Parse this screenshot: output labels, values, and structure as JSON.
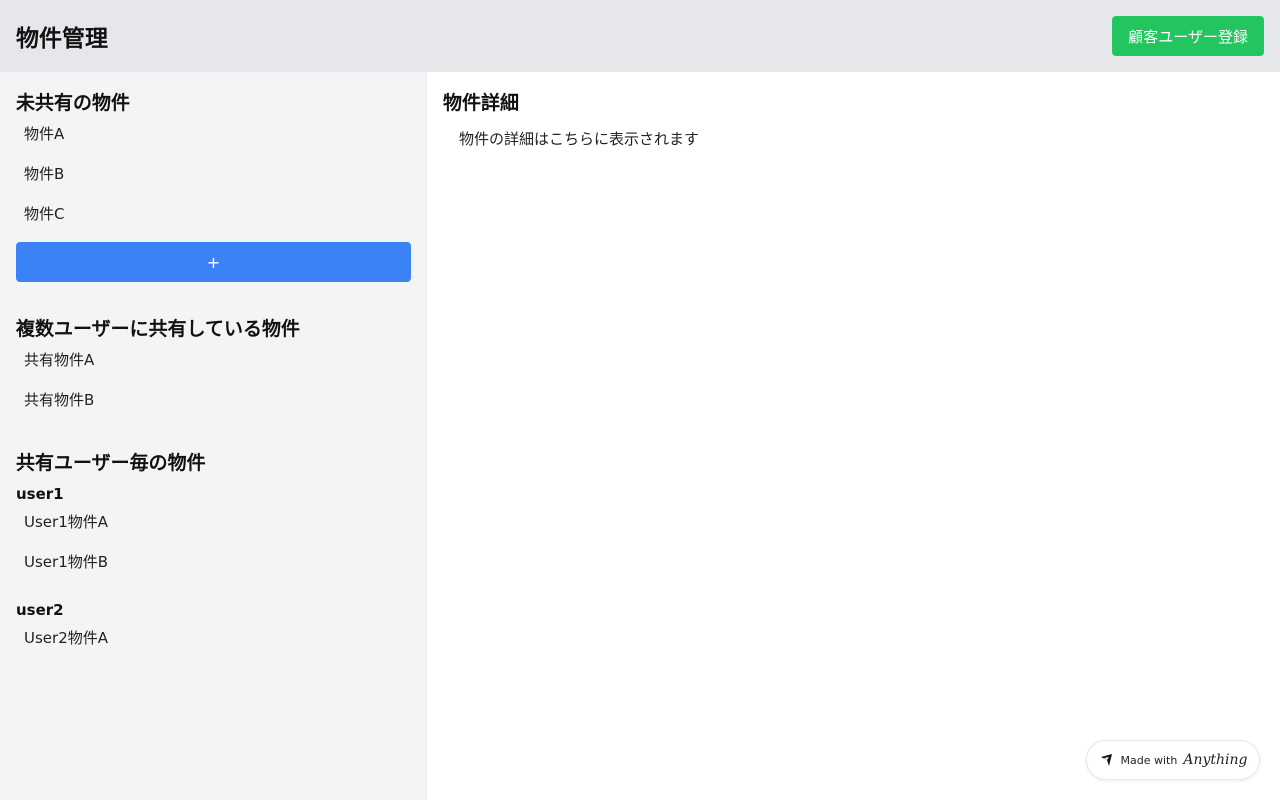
{
  "header": {
    "title": "物件管理",
    "register_button": "顧客ユーザー登録"
  },
  "sidebar": {
    "unshared": {
      "title": "未共有の物件",
      "items": [
        "物件A",
        "物件B",
        "物件C"
      ],
      "add_label": "+"
    },
    "shared_multi": {
      "title": "複数ユーザーに共有している物件",
      "items": [
        "共有物件A",
        "共有物件B"
      ]
    },
    "per_user": {
      "title": "共有ユーザー毎の物件",
      "users": [
        {
          "name": "user1",
          "items": [
            "User1物件A",
            "User1物件B"
          ]
        },
        {
          "name": "user2",
          "items": [
            "User2物件A"
          ]
        }
      ]
    }
  },
  "main": {
    "title": "物件詳細",
    "placeholder": "物件の詳細はこちらに表示されます"
  },
  "badge": {
    "prefix": "Made with",
    "brand": "Anything"
  },
  "colors": {
    "header_bg": "#e5e7eb",
    "sidebar_bg": "#f3f4f6",
    "register_button": "#22c55e",
    "add_button": "#3b82f6"
  }
}
